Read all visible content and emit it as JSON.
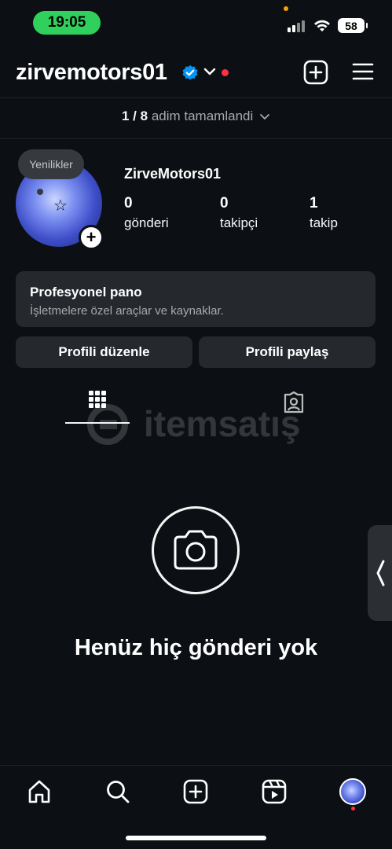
{
  "status_bar": {
    "time": "19:05",
    "battery": "58"
  },
  "header": {
    "username": "zirvemotors01"
  },
  "progress": {
    "count": "1 / 8",
    "text": "adim tamamlandi"
  },
  "profile": {
    "bubble": "Yenilikler",
    "display_name": "ZirveMotors01",
    "stats": [
      {
        "value": "0",
        "label": "gönderi"
      },
      {
        "value": "0",
        "label": "takipçi"
      },
      {
        "value": "1",
        "label": "takip"
      }
    ]
  },
  "pro_card": {
    "title": "Profesyonel pano",
    "subtitle": "İşletmelere özel araçlar ve kaynaklar."
  },
  "buttons": {
    "edit": "Profili düzenle",
    "share": "Profili paylaş"
  },
  "watermark": {
    "text": "itemsatış"
  },
  "empty_state": {
    "text": "Henüz hiç gönderi yok"
  },
  "colors": {
    "background": "#0c1014",
    "card": "#25292e",
    "time_pill": "#2fd15c",
    "verified": "#0095f6",
    "notification": "#ff3040"
  },
  "icons": [
    "signal-icon",
    "wifi-icon",
    "battery-icon",
    "verified-badge-icon",
    "chevron-down-icon",
    "new-post-icon",
    "menu-icon",
    "grid-icon",
    "tagged-icon",
    "camera-icon",
    "home-icon",
    "search-icon",
    "create-icon",
    "reels-icon",
    "profile-avatar"
  ]
}
